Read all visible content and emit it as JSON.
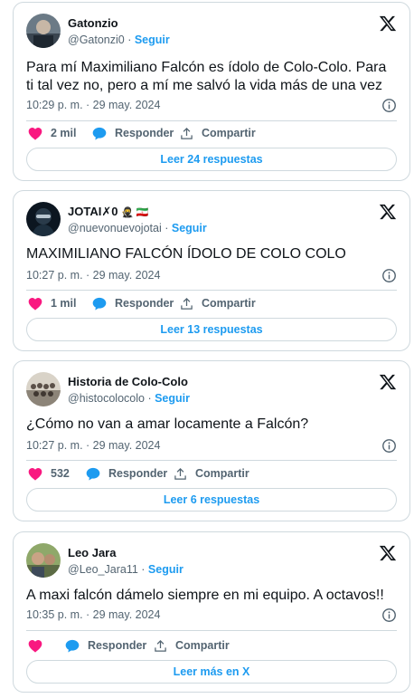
{
  "tweets": [
    {
      "name": "Gatonzio",
      "name_extra": "",
      "handle": "@Gatonzi0",
      "follow": "Seguir",
      "text": "Para mí Maximiliano Falcón es ídolo de Colo-Colo. Para ti tal vez no, pero a mí me salvó la vida más de una vez",
      "time": "10:29 p. m. · 29 may. 2024",
      "likes": "2 mil",
      "reply": "Responder",
      "share": "Compartir",
      "read": "Leer 24 respuestas"
    },
    {
      "name": "JOTAI✗0",
      "name_extra": "🥷 🇮🇷",
      "handle": "@nuevonuevojotai",
      "follow": "Seguir",
      "text": "MAXIMILIANO FALCÓN ÍDOLO DE COLO COLO",
      "time": "10:27 p. m. · 29 may. 2024",
      "likes": "1 mil",
      "reply": "Responder",
      "share": "Compartir",
      "read": "Leer 13 respuestas"
    },
    {
      "name": "Historia de Colo-Colo",
      "name_extra": "",
      "handle": "@histocolocolo",
      "follow": "Seguir",
      "text": "¿Cómo no van a amar locamente a Falcón?",
      "time": "10:27 p. m. · 29 may. 2024",
      "likes": "532",
      "reply": "Responder",
      "share": "Compartir",
      "read": "Leer 6 respuestas"
    },
    {
      "name": "Leo Jara",
      "name_extra": "",
      "handle": "@Leo_Jara11",
      "follow": "Seguir",
      "text": "A maxi falcón dámelo siempre en mi equipo. A octavos!!",
      "time": "10:35 p. m. · 29 may. 2024",
      "likes": "",
      "reply": "Responder",
      "share": "Compartir",
      "read": "Leer más en X"
    }
  ],
  "icons": {
    "x_logo": "x-logo-icon",
    "info": "info-icon",
    "like": "heart-icon",
    "reply": "reply-bubble-icon",
    "share": "share-upload-icon"
  },
  "colors": {
    "accent": "#1d9bf0",
    "like": "#f91880",
    "text": "#0f1419",
    "muted": "#536471",
    "border": "#cfd9de"
  }
}
